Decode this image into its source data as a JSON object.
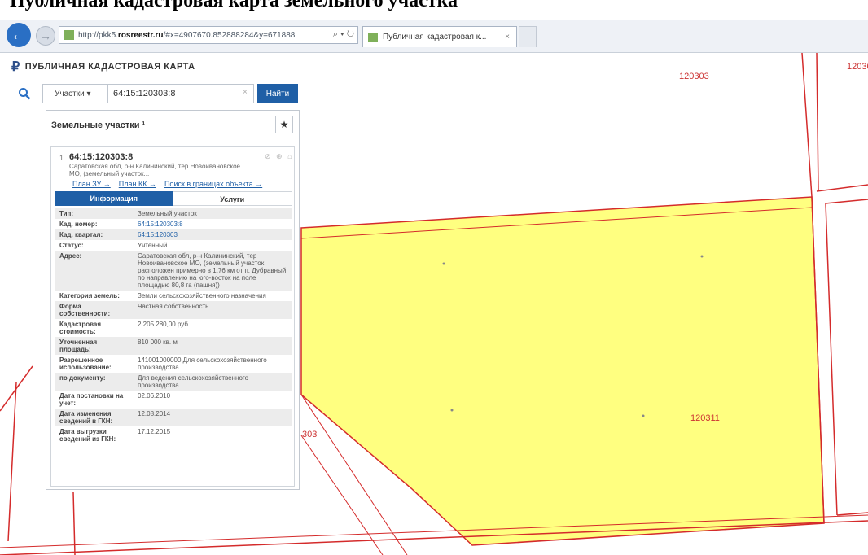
{
  "caption": "Публичная кадастровая карта земельного участка",
  "browser": {
    "url_prefix": "http://pkk5.",
    "url_domain": "rosreestr.ru",
    "url_suffix": "/#x=4907670.852888284&y=671888",
    "url_icons": "⌕ ▾ ↻",
    "tab_title": "Публичная кадастровая к...",
    "tab_close": "×"
  },
  "app": {
    "logo": "₽",
    "title": "ПУБЛИЧНАЯ КАДАСТРОВАЯ КАРТА"
  },
  "search": {
    "type": "Участки ▾",
    "value": "64:15:120303:8",
    "button": "Найти",
    "clear": "×"
  },
  "panel": {
    "title": "Земельные участки ¹",
    "index": "1",
    "cadnum": "64:15:120303:8",
    "address": "Саратовская обл, р-н Калининский, тер Новоивановское МО, (земельный участок...",
    "links": [
      "План ЗУ →",
      "План КК →",
      "Поиск в границах объекта →"
    ],
    "icons": "⊘ ⊕ ⌂",
    "tabs": {
      "info": "Информация",
      "services": "Услуги"
    },
    "attributes": [
      {
        "key": "Тип:",
        "value": "Земельный участок",
        "link": false
      },
      {
        "key": "Кад. номер:",
        "value": "64:15:120303:8",
        "link": true
      },
      {
        "key": "Кад. квартал:",
        "value": "64:15:120303",
        "link": true
      },
      {
        "key": "Статус:",
        "value": "Учтенный",
        "link": false
      },
      {
        "key": "Адрес:",
        "value": "Саратовская обл, р-н Калининский, тер Новоивановское МО, (земельный участок расположен примерно в 1,76 км от п. Дубравный по направлению на юго-восток на поле площадью 80,8 га (пашня))",
        "link": false
      },
      {
        "key": "Категория земель:",
        "value": "Земли сельскохозяйственного назначения",
        "link": false
      },
      {
        "key": "Форма собственности:",
        "value": "Частная собственность",
        "link": false
      },
      {
        "key": "Кадастровая стоимость:",
        "value": "2 205 280,00 руб.",
        "link": false
      },
      {
        "key": "Уточненная площадь:",
        "value": "810 000 кв. м",
        "link": false
      },
      {
        "key": "Разрешенное использование:",
        "value": "141001000000 Для сельскохозяйственного производства",
        "link": false
      },
      {
        "key": "по документу:",
        "value": "Для ведения сельскохозяйственного производства",
        "link": false
      },
      {
        "key": "Дата постановки на учет:",
        "value": "02.06.2010",
        "link": false
      },
      {
        "key": "Дата изменения сведений в ГКН:",
        "value": "12.08.2014",
        "link": false
      },
      {
        "key": "Дата выгрузки сведений из ГКН:",
        "value": "17.12.2015",
        "link": false
      }
    ]
  },
  "map_labels": {
    "quarter_top": "120303",
    "quarter_right": "12030",
    "parcel": "120311",
    "side": "303"
  },
  "colors": {
    "parcel_fill": "#ffff80",
    "boundary": "#d42b2b",
    "accent": "#1f5fa6"
  }
}
